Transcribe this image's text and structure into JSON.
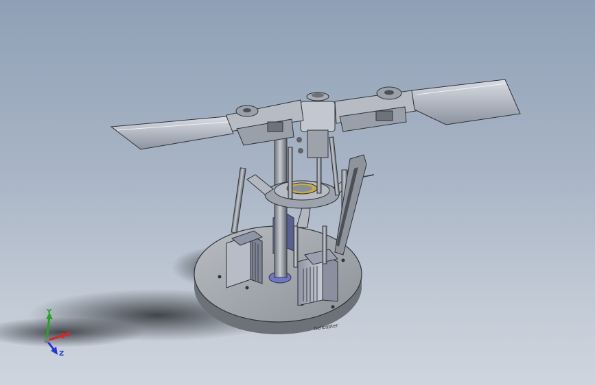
{
  "viewport": {
    "name": "3D model graphics area",
    "background_top": "#8fa0b6",
    "background_bottom": "#cfd5de"
  },
  "model": {
    "description_icon": "helicopter-rotor-head-assembly-icon",
    "base_engraving": "helicopter"
  },
  "triad": {
    "x_label": "X",
    "y_label": "Y",
    "z_label": "Z",
    "x_color": "#d22a2a",
    "y_color": "#2aa12a",
    "z_color": "#2a36d2"
  }
}
